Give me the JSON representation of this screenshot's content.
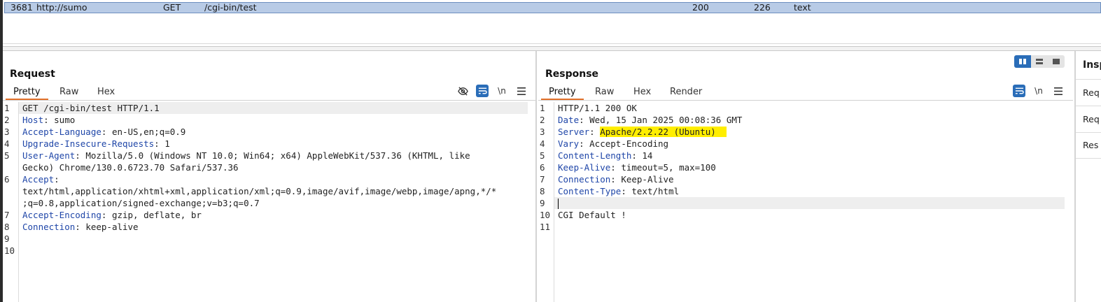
{
  "history": {
    "row": {
      "id": "3681",
      "host": "http://sumo",
      "method": "GET",
      "url": "/cgi-bin/test",
      "status": "200",
      "length": "226",
      "mime": "text"
    }
  },
  "request": {
    "title": "Request",
    "tabs": [
      "Pretty",
      "Raw",
      "Hex"
    ],
    "lines": [
      {
        "n": "1",
        "key": "",
        "val": "GET /cgi-bin/test HTTP/1.1"
      },
      {
        "n": "2",
        "key": "Host",
        "val": ": sumo"
      },
      {
        "n": "3",
        "key": "Accept-Language",
        "val": ": en-US,en;q=0.9"
      },
      {
        "n": "4",
        "key": "Upgrade-Insecure-Requests",
        "val": ": 1"
      },
      {
        "n": "5",
        "key": "User-Agent",
        "val": ": Mozilla/5.0 (Windows NT 10.0; Win64; x64) AppleWebKit/537.36 (KHTML, like"
      },
      {
        "n": "",
        "key": "",
        "val": "Gecko) Chrome/130.0.6723.70 Safari/537.36"
      },
      {
        "n": "6",
        "key": "Accept",
        "val": ":"
      },
      {
        "n": "",
        "key": "",
        "val": "text/html,application/xhtml+xml,application/xml;q=0.9,image/avif,image/webp,image/apng,*/*"
      },
      {
        "n": "",
        "key": "",
        "val": ";q=0.8,application/signed-exchange;v=b3;q=0.7"
      },
      {
        "n": "7",
        "key": "Accept-Encoding",
        "val": ": gzip, deflate, br"
      },
      {
        "n": "8",
        "key": "Connection",
        "val": ": keep-alive"
      },
      {
        "n": "9",
        "key": "",
        "val": ""
      },
      {
        "n": "10",
        "key": "",
        "val": ""
      }
    ]
  },
  "response": {
    "title": "Response",
    "tabs": [
      "Pretty",
      "Raw",
      "Hex",
      "Render"
    ],
    "lines": [
      {
        "n": "1",
        "key": "",
        "val": "HTTP/1.1 200 OK"
      },
      {
        "n": "2",
        "key": "Date",
        "val": ": Wed, 15 Jan 2025 00:08:36 GMT"
      },
      {
        "n": "3",
        "key": "Server",
        "val": ": ",
        "hl": "Apache/2.2.22 (Ubuntu)"
      },
      {
        "n": "4",
        "key": "Vary",
        "val": ": Accept-Encoding"
      },
      {
        "n": "5",
        "key": "Content-Length",
        "val": ": 14"
      },
      {
        "n": "6",
        "key": "Keep-Alive",
        "val": ": timeout=5, max=100"
      },
      {
        "n": "7",
        "key": "Connection",
        "val": ": Keep-Alive"
      },
      {
        "n": "8",
        "key": "Content-Type",
        "val": ": text/html"
      },
      {
        "n": "9",
        "key": "",
        "val": ""
      },
      {
        "n": "10",
        "key": "",
        "val": "CGI Default !"
      },
      {
        "n": "11",
        "key": "",
        "val": ""
      }
    ]
  },
  "icons": {
    "hide": "eye-off-icon",
    "wrap": "wrap-icon",
    "newline": "\\n",
    "menu": "menu-icon"
  },
  "inspector": {
    "title": "Insp",
    "items": [
      "Req",
      "Req",
      "Res"
    ]
  },
  "colors": {
    "accent": "#2a6db8",
    "tab_active": "#e2702a",
    "header_key": "#1f46a8",
    "highlight": "#ffee00",
    "selected_row": "#b8cbe6"
  }
}
